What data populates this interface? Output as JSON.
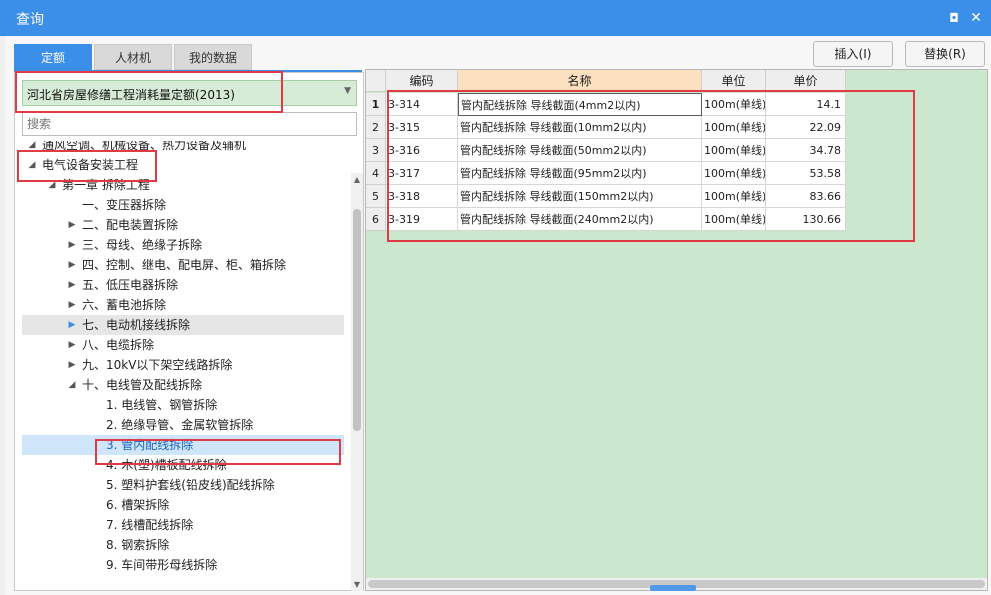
{
  "window": {
    "title": "查询",
    "max_icon": "maximize-icon",
    "close_icon": "close-icon",
    "max_glyph": "◘",
    "close_glyph": "✕"
  },
  "tabs": [
    {
      "label": "定额",
      "active": true
    },
    {
      "label": "人材机",
      "active": false
    },
    {
      "label": "我的数据",
      "active": false
    }
  ],
  "buttons": {
    "insert": "插入(I)",
    "replace": "替换(R)"
  },
  "library": {
    "selected": "河北省房屋修缮工程消耗量定额(2013)"
  },
  "search": {
    "placeholder": "搜索"
  },
  "tree": [
    {
      "label": "通风空调、机械设备、热力设备及辅机",
      "level": 0,
      "exp": "◢"
    },
    {
      "label": "电气设备安装工程",
      "level": 0,
      "exp": "◢"
    },
    {
      "label": "第一章 拆除工程",
      "level": 1,
      "exp": "◢"
    },
    {
      "label": "一、变压器拆除",
      "level": 2,
      "exp": ""
    },
    {
      "label": "二、配电装置拆除",
      "level": 2,
      "exp": "▶"
    },
    {
      "label": "三、母线、绝缘子拆除",
      "level": 2,
      "exp": "▶"
    },
    {
      "label": "四、控制、继电、配电屏、柜、箱拆除",
      "level": 2,
      "exp": "▶"
    },
    {
      "label": "五、低压电器拆除",
      "level": 2,
      "exp": "▶"
    },
    {
      "label": "六、蓄电池拆除",
      "level": 2,
      "exp": "▶"
    },
    {
      "label": "七、电动机接线拆除",
      "level": 2,
      "exp": "▶",
      "state": "hover"
    },
    {
      "label": "八、电缆拆除",
      "level": 2,
      "exp": "▶"
    },
    {
      "label": "九、10kV以下架空线路拆除",
      "level": 2,
      "exp": "▶"
    },
    {
      "label": "十、电线管及配线拆除",
      "level": 2,
      "exp": "◢"
    },
    {
      "label": "1. 电线管、钢管拆除",
      "level": 3,
      "exp": ""
    },
    {
      "label": "2. 绝缘导管、金属软管拆除",
      "level": 3,
      "exp": ""
    },
    {
      "label": "3. 管内配线拆除",
      "level": 3,
      "exp": "",
      "state": "selected"
    },
    {
      "label": "4. 木(塑)槽板配线拆除",
      "level": 3,
      "exp": ""
    },
    {
      "label": "5. 塑料护套线(铅皮线)配线拆除",
      "level": 3,
      "exp": ""
    },
    {
      "label": "6. 槽架拆除",
      "level": 3,
      "exp": ""
    },
    {
      "label": "7. 线槽配线拆除",
      "level": 3,
      "exp": ""
    },
    {
      "label": "8. 钢索拆除",
      "level": 3,
      "exp": ""
    },
    {
      "label": "9. 车间带形母线拆除",
      "level": 3,
      "exp": ""
    }
  ],
  "grid": {
    "columns": [
      "编码",
      "名称",
      "单位",
      "单价"
    ],
    "rows": [
      {
        "n": "1",
        "code": "3-314",
        "name": "管内配线拆除 导线截面(4mm2以内)",
        "unit": "100m(单线)",
        "price": "14.1"
      },
      {
        "n": "2",
        "code": "3-315",
        "name": "管内配线拆除 导线截面(10mm2以内)",
        "unit": "100m(单线)",
        "price": "22.09"
      },
      {
        "n": "3",
        "code": "3-316",
        "name": "管内配线拆除 导线截面(50mm2以内)",
        "unit": "100m(单线)",
        "price": "34.78"
      },
      {
        "n": "4",
        "code": "3-317",
        "name": "管内配线拆除 导线截面(95mm2以内)",
        "unit": "100m(单线)",
        "price": "53.58"
      },
      {
        "n": "5",
        "code": "3-318",
        "name": "管内配线拆除 导线截面(150mm2以内)",
        "unit": "100m(单线)",
        "price": "83.66"
      },
      {
        "n": "6",
        "code": "3-319",
        "name": "管内配线拆除 导线截面(240mm2以内)",
        "unit": "100m(单线)",
        "price": "130.66"
      }
    ]
  },
  "colors": {
    "accent": "#3c8fe8",
    "highlight": "#e03a45",
    "grid_bg": "#cbe8cf"
  }
}
